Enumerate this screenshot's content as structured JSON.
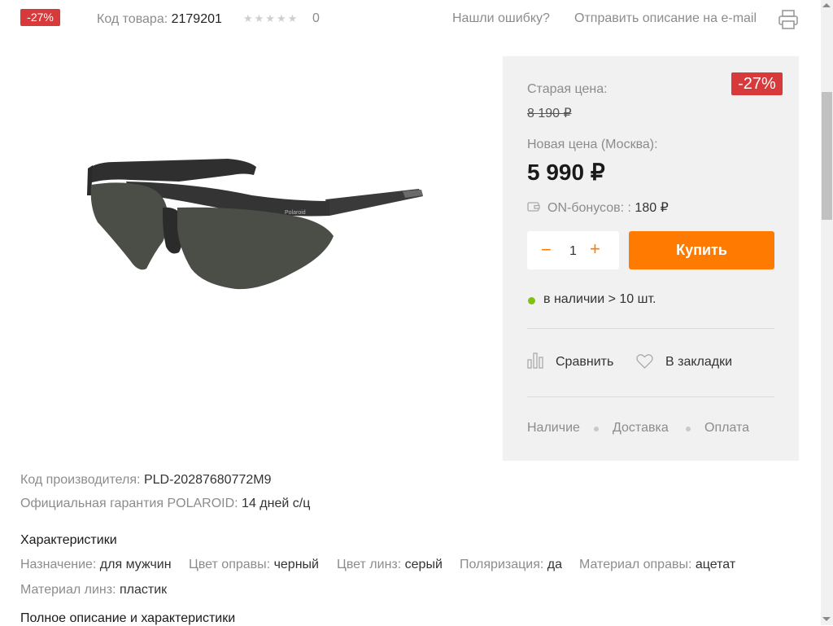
{
  "top_bar": {
    "discount_badge": "-27%",
    "sku_label": "Код товара:",
    "sku_value": "2179201",
    "rating_stars": "★★★★★",
    "rating_count": "0",
    "report_error_link": "Нашли ошибку?",
    "send_email_link": "Отправить описание на e-mail",
    "print_icon": "printer-icon"
  },
  "product_image": {
    "icon": "sunglasses-image",
    "brand_text": "Polaroid"
  },
  "price_panel": {
    "discount_badge": "-27%",
    "old_price_label": "Старая цена:",
    "old_price": "8 190 ₽",
    "new_price_label": "Новая цена (Москва):",
    "new_price": "5 990 ₽",
    "bonus_icon": "wallet-icon",
    "bonus_label": "ON-бонусов: :",
    "bonus_value": "180 ₽",
    "qty_minus": "−",
    "qty_value": "1",
    "qty_plus": "+",
    "buy_button": "Купить",
    "stock_text": "в наличии > 10 шт.",
    "compare_label": "Сравнить",
    "bookmark_label": "В закладки",
    "info_links": [
      "Наличие",
      "Доставка",
      "Оплата"
    ]
  },
  "details": {
    "manufacturer_code_label": "Код производителя:",
    "manufacturer_code_value": "PLD-20287680772M9",
    "warranty_label": "Официальная гарантия POLAROID:",
    "warranty_value": "14 дней с/ц",
    "characteristics_heading": "Характеристики",
    "attributes": [
      {
        "label": "Назначение:",
        "value": "для мужчин"
      },
      {
        "label": "Цвет оправы:",
        "value": "черный"
      },
      {
        "label": "Цвет линз:",
        "value": "серый"
      },
      {
        "label": "Поляризация:",
        "value": "да"
      },
      {
        "label": "Материал оправы:",
        "value": "ацетат"
      },
      {
        "label": "Материал линз:",
        "value": "пластик"
      }
    ],
    "full_description_link": "Полное описание и характеристики"
  },
  "colors": {
    "accent": "#ff7a00",
    "discount": "#d8393a",
    "stock": "#7bc414",
    "panel_bg": "#f1f1f1"
  }
}
